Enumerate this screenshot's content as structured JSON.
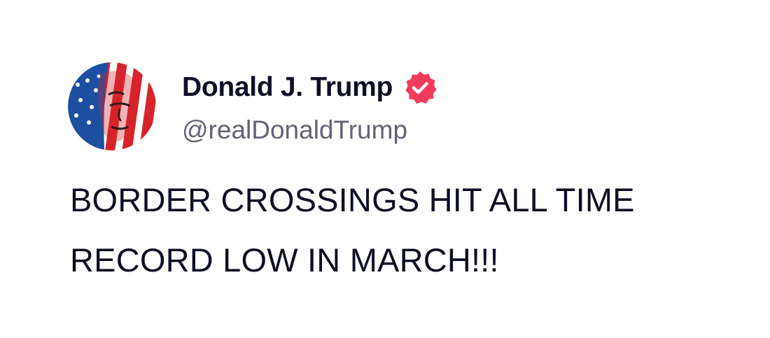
{
  "post": {
    "author": {
      "display_name": "Donald J. Trump",
      "handle": "@realDonaldTrump",
      "verified": true,
      "avatar_icon": "avatar-flag-portrait",
      "verified_icon": "verified-badge-icon",
      "verified_color": "#f23c5d"
    },
    "text": "BORDER CROSSINGS HIT ALL TIME\nRECORD LOW IN MARCH!!!"
  },
  "colors": {
    "name": "#0e0f24",
    "handle": "#636277",
    "body_text": "#0e0f24",
    "background": "#ffffff"
  }
}
